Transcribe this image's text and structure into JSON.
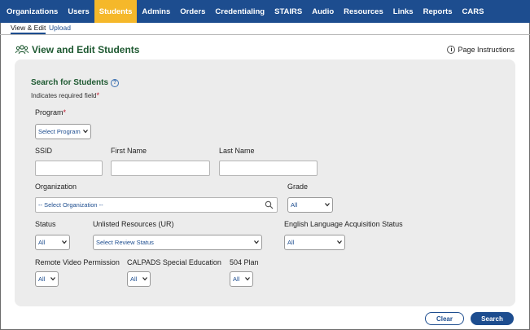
{
  "nav": {
    "items": [
      "Organizations",
      "Users",
      "Students",
      "Admins",
      "Orders",
      "Credentialing",
      "STAIRS",
      "Audio",
      "Resources",
      "Links",
      "Reports",
      "CARS"
    ],
    "active_index": 2
  },
  "subtabs": {
    "view_edit": "View & Edit",
    "upload": "Upload"
  },
  "page": {
    "title": "View and Edit Students",
    "instructions": "Page Instructions"
  },
  "search": {
    "title": "Search for Students",
    "required_note": "Indicates required field",
    "required_mark": "*"
  },
  "fields": {
    "program_label": "Program",
    "program_value": "Select Program",
    "ssid_label": "SSID",
    "first_name_label": "First Name",
    "last_name_label": "Last Name",
    "organization_label": "Organization",
    "organization_value": "-- Select Organization --",
    "grade_label": "Grade",
    "grade_value": "All",
    "status_label": "Status",
    "status_value": "All",
    "ur_label": "Unlisted Resources (UR)",
    "ur_value": "Select Review Status",
    "elas_label": "English Language Acquisition Status",
    "elas_value": "All",
    "rvp_label": "Remote Video Permission",
    "rvp_value": "All",
    "calpads_label": "CALPADS Special Education",
    "calpads_value": "All",
    "plan504_label": "504 Plan",
    "plan504_value": "All"
  },
  "buttons": {
    "clear": "Clear",
    "search": "Search"
  },
  "colors": {
    "nav_bg": "#1d4d8f",
    "nav_active": "#f5b82a",
    "title_green": "#1f5a32",
    "required_red": "#c0142a"
  }
}
